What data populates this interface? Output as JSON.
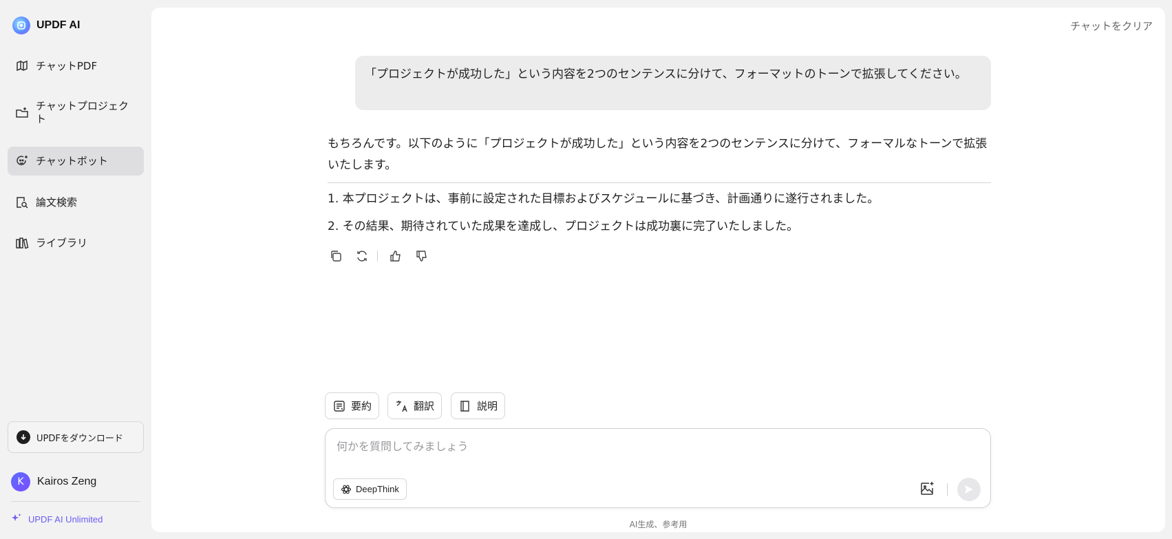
{
  "app": {
    "title": "UPDF AI"
  },
  "sidebar": {
    "items": [
      {
        "label": "チャットPDF",
        "icon": "book-icon"
      },
      {
        "label": "チャットプロジェクト",
        "icon": "folder-plus-icon"
      },
      {
        "label": "チャットボット",
        "icon": "bot-icon",
        "active": true
      },
      {
        "label": "論文検索",
        "icon": "doc-search-icon"
      },
      {
        "label": "ライブラリ",
        "icon": "library-icon"
      }
    ],
    "download_label": "UPDFをダウンロード",
    "user": {
      "initial": "K",
      "name": "Kairos Zeng"
    },
    "unlimited_label": "UPDF AI Unlimited"
  },
  "header": {
    "clear_label": "チャットをクリア"
  },
  "chat": {
    "user_message": "「プロジェクトが成功した」という内容を2つのセンテンスに分けて、フォーマットのトーンで拡張してください。",
    "answer_intro": "もちろんです。以下のように「プロジェクトが成功した」という内容を2つのセンテンスに分けて、フォーマルなトーンで拡張いたします。",
    "answer_items": [
      "1. 本プロジェクトは、事前に設定された目標およびスケジュールに基づき、計画通りに遂行されました。",
      "2. その結果、期待されていた成果を達成し、プロジェクトは成功裏に完了いたしました。"
    ]
  },
  "quick_actions": [
    {
      "label": "要約",
      "icon": "summary-icon"
    },
    {
      "label": "翻訳",
      "icon": "translate-icon"
    },
    {
      "label": "説明",
      "icon": "explain-book-icon"
    }
  ],
  "composer": {
    "placeholder": "何かを質問してみましょう",
    "value": "",
    "deepthink_label": "DeepThink"
  },
  "footer": {
    "disclaimer": "AI生成、参考用"
  },
  "colors": {
    "accent": "#6b5cf0",
    "active_bg": "#dedee0",
    "page_bg": "#f2f2f3"
  }
}
